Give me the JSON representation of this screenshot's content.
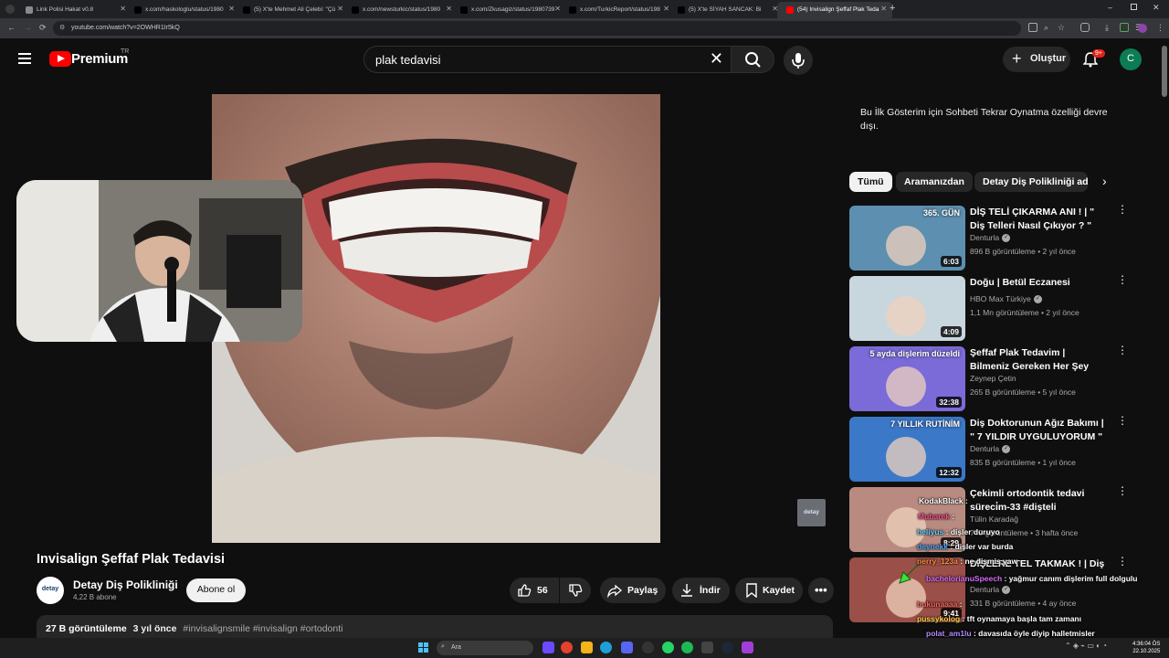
{
  "browser": {
    "tabs": [
      {
        "label": "Link Polisi Hakat v0.8",
        "active": false
      },
      {
        "label": "x.com/haskologlu/status/1980",
        "active": false
      },
      {
        "label": "(5) X'te Mehmet Ali Çelebi: \"Çü",
        "active": false
      },
      {
        "label": "x.com/newsturkic/status/1980",
        "active": false
      },
      {
        "label": "x.com/Zkusagiz/status/1980739",
        "active": false
      },
      {
        "label": "x.com/TurkicReport/status/198",
        "active": false
      },
      {
        "label": "(5) X'te SİYAH SANCAK: Bi",
        "active": false
      },
      {
        "label": "(54) Invisalign Şeffaf Plak Teda",
        "active": true
      }
    ],
    "url": "youtube.com/watch?v=2OWHR1Ir5kQ"
  },
  "header": {
    "logo_text": "Premium",
    "region": "TR",
    "search_value": "plak tedavisi",
    "create_label": "Oluştur",
    "notif_count": "9+",
    "avatar_letter": "C"
  },
  "video": {
    "title": "Invisalign Şeffaf Plak Tedavisi",
    "channel": "Detay Diş Polikliniği",
    "channel_logo": "detay",
    "subscribers": "4,22 B abone",
    "subscribe_label": "Abone ol",
    "likes": "56",
    "share_label": "Paylaş",
    "download_label": "İndir",
    "save_label": "Kaydet",
    "views": "27 B görüntüleme",
    "age": "3 yıl önce",
    "hashtags": "#invisalignsmile #invisalign #ortodonti"
  },
  "sidebar": {
    "chat_notice": "Bu İlk Gösterim için Sohbeti Tekrar Oynatma özelliği devre dışı.",
    "chips": [
      "Tümü",
      "Aramanızdan",
      "Detay Diş Polikliniği adlı"
    ],
    "recommendations": [
      {
        "title": "DİŞ TELİ ÇIKARMA ANI ! | \" Diş Telleri Nasıl Çıkıyor ? \"",
        "channel": "Denturla",
        "verified": true,
        "meta": "896 B görüntüleme • 2 yıl önce",
        "duration": "6:03",
        "thumb_text": "365. GÜN",
        "thumb_color": "#5c8fb0"
      },
      {
        "title": "Doğu | Betül Eczanesi",
        "channel": "HBO Max Türkiye",
        "verified": true,
        "meta": "1,1 Mn görüntüleme • 2 yıl önce",
        "duration": "4:09",
        "thumb_text": "",
        "thumb_color": "#c8d6de"
      },
      {
        "title": "Şeffaf Plak Tedavim | Bilmeniz Gereken Her Şey",
        "channel": "Zeynep Çetin",
        "verified": false,
        "meta": "265 B görüntüleme • 5 yıl önce",
        "duration": "32:38",
        "thumb_text": "5 ayda dişlerim düzeldi",
        "thumb_color": "#7a6bd8"
      },
      {
        "title": "Diş Doktorunun Ağız Bakımı | \" 7 YILDIR UYGULUYORUM \"",
        "channel": "Denturla",
        "verified": true,
        "meta": "835 B görüntüleme • 1 yıl önce",
        "duration": "12:32",
        "thumb_text": "7 YILLIK RUTİNİM",
        "thumb_color": "#3b78c8"
      },
      {
        "title": "Çekimli ortodontik tedavi süreci̇m-33 #dişteli #ortodonti...",
        "channel": "Tülin Karadağ",
        "verified": false,
        "meta": "740 görüntüleme • 3 hafta önce",
        "duration": "8:29",
        "thumb_text": "",
        "thumb_color": "#b98a80"
      },
      {
        "title": "DİŞLERE TEL TAKMAK ! | Diş",
        "channel": "Denturla",
        "verified": true,
        "meta": "331 B görüntüleme • 4 ay önce",
        "duration": "9:41",
        "thumb_text": "",
        "thumb_color": "#9a5048"
      }
    ]
  },
  "chat": [
    {
      "user": "KodakBlack",
      "text": ":",
      "color": "#ffffff"
    },
    {
      "user": "Mubarek",
      "text": ":",
      "color": "#ff4d8d"
    },
    {
      "user": "heliyus",
      "text": ": dişler duruyo",
      "color": "#5fd0ff"
    },
    {
      "user": "deynekk",
      "text": ": dişler var burda",
      "color": "#4aa8ff"
    },
    {
      "user": "perry_123a",
      "text": ": ne dişmis yaw",
      "color": "#ff8c42"
    },
    {
      "user": "bachelorianuSpeech",
      "text": ": yağmur canım dişlerim full dolgulu",
      "color": "#d86bff"
    },
    {
      "user": "bukunaaaa",
      "text": ":",
      "color": "#ff6060"
    },
    {
      "user": "pussykolog",
      "text": ": tft oynamaya başla tam zamanı",
      "color": "#ffd24a"
    },
    {
      "user": "polat_am1lu",
      "text": ": davasıda öyle diyip halletmisler",
      "color": "#b48cff"
    },
    {
      "user": "heliyus",
      "text": ":",
      "color": "#ffffff"
    }
  ],
  "taskbar": {
    "search_placeholder": "Ara",
    "time": "4:36:04 ÖS",
    "date": "22.10.2025"
  },
  "colors": {
    "background": "#0f0f0f",
    "accent_red": "#ff0000",
    "chip_bg": "#272727"
  }
}
